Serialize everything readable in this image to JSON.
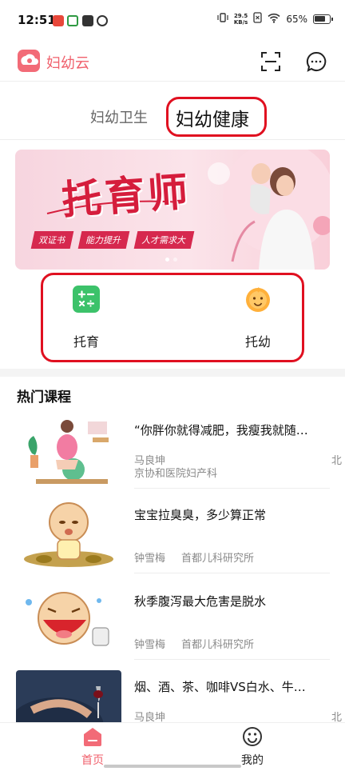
{
  "status_bar": {
    "time": "12:51",
    "net_speed_top": "29.5",
    "net_speed_bottom": "KB/s",
    "battery": "65%"
  },
  "header": {
    "app_name": "妇幼云"
  },
  "tabs": [
    {
      "label": "妇幼卫生"
    },
    {
      "label": "妇幼健康"
    }
  ],
  "banner": {
    "title": "托育师",
    "tags": [
      "双证书",
      "能力提升",
      "人才需求大"
    ]
  },
  "categories": [
    {
      "label": "托育",
      "icon": "calculator-icon"
    },
    {
      "label": "托幼",
      "icon": "baby-face-icon"
    }
  ],
  "courses_section": {
    "title": "热门课程"
  },
  "courses": [
    {
      "title": "“你胖你就得减肥，我瘦我就随…",
      "author": "马良坤",
      "org": "京协和医院妇产科",
      "right": "北"
    },
    {
      "title": "宝宝拉臭臭，多少算正常",
      "author": "钟雪梅",
      "org": "首都儿科研究所",
      "right": ""
    },
    {
      "title": "秋季腹泻最大危害是脱水",
      "author": "钟雪梅",
      "org": "首都儿科研究所",
      "right": ""
    },
    {
      "title": "烟、酒、茶、咖啡VS白水、牛…",
      "author": "马良坤",
      "org": "",
      "right": "北"
    }
  ],
  "bottom_nav": [
    {
      "label": "首页"
    },
    {
      "label": "我的"
    }
  ],
  "colors": {
    "brand": "#f0606c",
    "highlight_ring": "#e01020"
  }
}
